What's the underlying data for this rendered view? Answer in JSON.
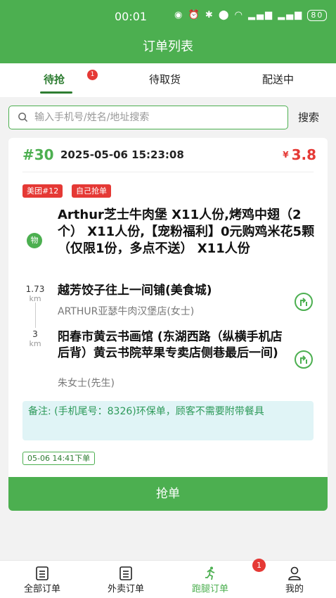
{
  "status_bar": {
    "time": "00:01",
    "battery": "80"
  },
  "header": {
    "title": "订单列表"
  },
  "tabs": [
    {
      "label": "待抢",
      "active": true,
      "badge": "1"
    },
    {
      "label": "待取货",
      "active": false
    },
    {
      "label": "配送中",
      "active": false
    }
  ],
  "search": {
    "placeholder": "输入手机号/姓名/地址搜索",
    "value": "",
    "button_label": "搜索"
  },
  "order": {
    "number": "#30",
    "time": "2025-05-06 15:23:08",
    "price_symbol": "¥",
    "price": "3.8",
    "tags": [
      "美团#12",
      "自己抢单"
    ],
    "goods_icon_label": "物",
    "goods": "Arthur芝士牛肉堡 X11人份,烤鸡中翅（2个） X11人份,【宠粉福利】0元购鸡米花5颗（仅限1份，多点不送） X11人份",
    "pickup": {
      "distance": "1.73",
      "unit": "km",
      "name": "越芳饺子往上一间铺(美食城)",
      "sub": "ARTHUR亚瑟牛肉汉堡店(女士)"
    },
    "dropoff": {
      "distance": "3",
      "unit": "km",
      "name": "阳春市黄云书画馆 (东湖西路（纵横手机店后背）黄云书院苹果专卖店侧巷最后一间)",
      "sub": "朱女士(先生)"
    },
    "remark": "备注: (手机尾号：8326)环保单，顾客不需要附带餐具",
    "order_time_tag": "05-06 14:41下单",
    "grab_label": "抢单"
  },
  "bottom_nav": [
    {
      "label": "全部订单",
      "icon": "list-icon",
      "active": false
    },
    {
      "label": "外卖订单",
      "icon": "list-icon",
      "active": false
    },
    {
      "label": "跑腿订单",
      "icon": "runner-icon",
      "active": true,
      "badge": "1"
    },
    {
      "label": "我的",
      "icon": "user-icon",
      "active": false
    }
  ],
  "colors": {
    "primary": "#4caf50",
    "accent_red": "#e53935",
    "remark_bg": "#e0f4f6"
  }
}
